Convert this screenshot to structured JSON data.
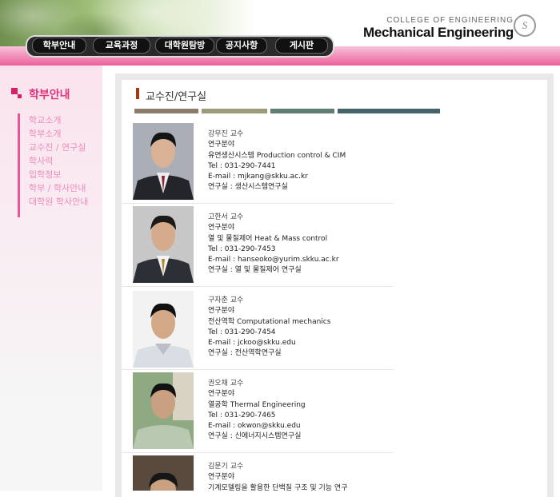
{
  "header": {
    "nav": [
      "학부안내",
      "교육과정",
      "대학원탐방",
      "공지사항",
      "게시판"
    ],
    "brand_small": "COLLEGE OF ENGINEERING",
    "brand_big": "Mechanical Engineering",
    "seal_letter": "S"
  },
  "sidebar": {
    "title": "학부안내",
    "items": [
      "학교소개",
      "학부소개",
      "교수진 / 연구실",
      "학사력",
      "입학정보",
      "학부 / 학사안내",
      "대학원 학사안내"
    ]
  },
  "content": {
    "heading": "교수진/연구실",
    "bar_colors": [
      "#8c7d6a",
      "#9b9b79",
      "#5f7d72",
      "#45636a"
    ],
    "professors": [
      {
        "name": "강무진 교수",
        "field_label": "연구분야",
        "field": "유연생산시스템 Production control & CIM",
        "tel": "Tel : 031-290-7441",
        "email": "E-mail : mjkang@skku.ac.kr",
        "lab": "연구실 : 생산시스템연구실"
      },
      {
        "name": "고한서 교수",
        "field_label": "연구분야",
        "field": "열 및 물질제어 Heat & Mass control",
        "tel": "Tel : 031-290-7453",
        "email": "E-mail : hanseoko@yurim.skku.ac.kr",
        "lab": "연구실 : 열 및 물질제어 연구실"
      },
      {
        "name": "구자춘 교수",
        "field_label": "연구분야",
        "field": "전산역학 Computational mechanics",
        "tel": "Tel : 031-290-7454",
        "email": "E-mail : jckoo@skku.edu",
        "lab": "연구실 : 전산역학연구실"
      },
      {
        "name": "권오채 교수",
        "field_label": "연구분야",
        "field": "열공학 Thermal Engineering",
        "tel": "Tel : 031-290-7465",
        "email": "E-mail : okwon@skku.edu",
        "lab": "연구실 : 신에너지시스템연구실"
      },
      {
        "name": "김문기 교수",
        "field_label": "연구분야",
        "field": "기계모델링을 활용한 단백질 구조 및 기능 연구",
        "tel": "",
        "email": "",
        "lab": ""
      }
    ]
  }
}
